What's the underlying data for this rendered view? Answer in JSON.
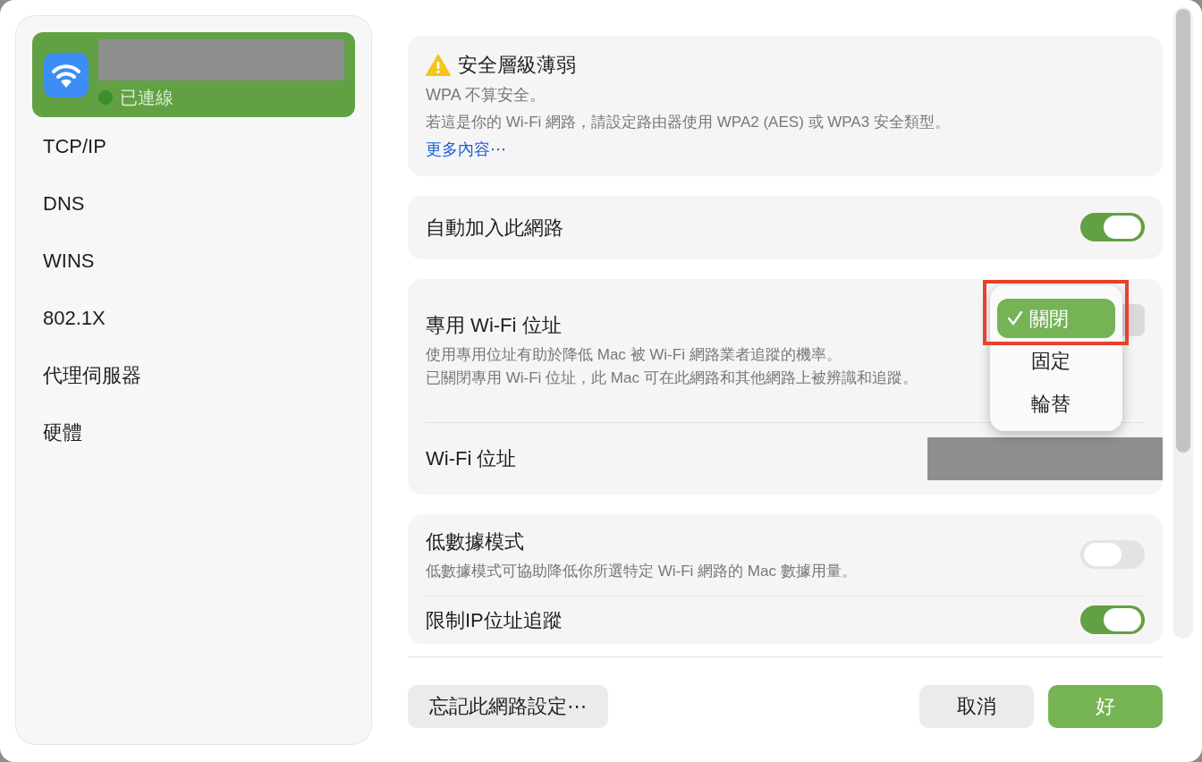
{
  "sidebar": {
    "network": {
      "selected": true,
      "status": "已連線",
      "connected": true
    },
    "items": [
      {
        "label": "TCP/IP",
        "selected": false
      },
      {
        "label": "DNS",
        "selected": false
      },
      {
        "label": "WINS",
        "selected": false
      },
      {
        "label": "802.1X",
        "selected": false
      },
      {
        "label": "代理伺服器",
        "selected": false
      },
      {
        "label": "硬體",
        "selected": false
      }
    ]
  },
  "security_warning": {
    "title": "安全層級薄弱",
    "subtitle": "WPA 不算安全。",
    "body": "若這是你的 Wi-Fi 網路，請設定路由器使用 WPA2 (AES) 或 WPA3 安全類型。",
    "link": "更多內容⋯"
  },
  "cards": [
    {
      "rows": [
        {
          "kind": "toggle",
          "label": "自動加入此網路",
          "on": true
        }
      ]
    },
    {
      "rows": [
        {
          "kind": "popup",
          "label": "專用 Wi-Fi 位址",
          "description_lines": [
            "使用專用位址有助於降低 Mac 被 Wi-Fi 網路業者追蹤的機率。",
            "已關閉專用 Wi-Fi 位址，此 Mac 可在此網路和其他網路上被辨識和追蹤。"
          ],
          "menu": [
            {
              "label": "關閉",
              "selected": true
            },
            {
              "label": "固定",
              "selected": false
            },
            {
              "label": "輪替",
              "selected": false
            }
          ]
        },
        {
          "kind": "value",
          "label": "Wi-Fi 位址"
        }
      ]
    },
    {
      "rows": [
        {
          "kind": "toggle",
          "label": "低數據模式",
          "description": "低數據模式可協助降低你所選特定 Wi-Fi 網路的 Mac 數據用量。",
          "on": false
        },
        {
          "kind": "toggle",
          "label": "限制IP位址追蹤",
          "on": true
        }
      ]
    }
  ],
  "footer": {
    "forget_button": "忘記此網路設定⋯",
    "cancel_button": "取消",
    "ok_button": "好"
  }
}
